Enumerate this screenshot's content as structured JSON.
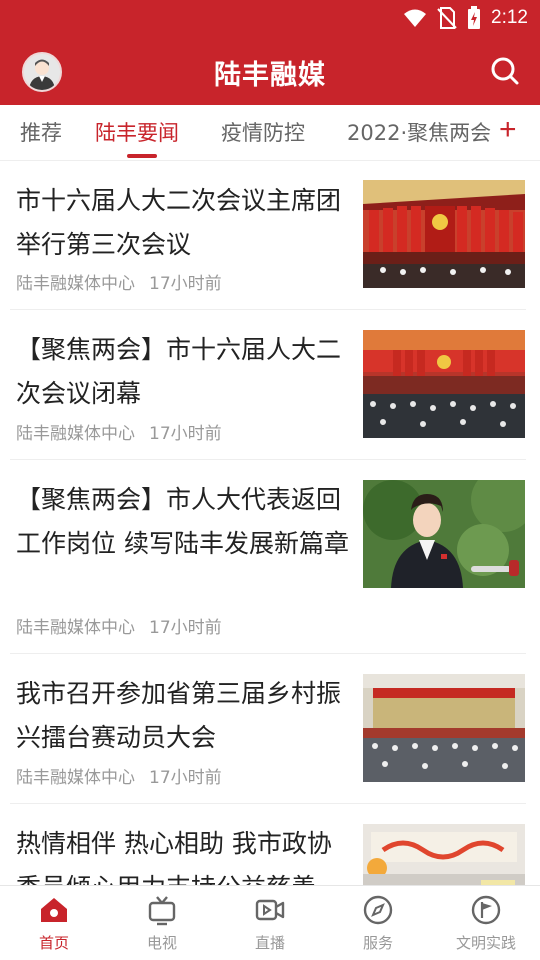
{
  "status_bar": {
    "time": "2:12"
  },
  "header": {
    "title": "陆丰融媒",
    "avatar_icon": "user-avatar",
    "search_icon": "search-icon"
  },
  "tabs": [
    {
      "label": "推荐",
      "active": false
    },
    {
      "label": "陆丰要闻",
      "active": true
    },
    {
      "label": "疫情防控",
      "active": false
    },
    {
      "label": "2022·聚焦两会",
      "active": false
    }
  ],
  "tab_add": "+",
  "news": [
    {
      "title": "市十六届人大二次会议主席团举行第三次会议",
      "source": "陆丰融媒体中心",
      "time": "17小时前",
      "thumb": "meeting-hall"
    },
    {
      "title": "【聚焦两会】市十六届人大二次会议闭幕",
      "source": "陆丰融媒体中心",
      "time": "17小时前",
      "thumb": "meeting-hall-wide"
    },
    {
      "title": "【聚焦两会】市人大代表返回工作岗位 续写陆丰发展新篇章",
      "source": "陆丰融媒体中心",
      "time": "17小时前",
      "thumb": "interview-portrait"
    },
    {
      "title": "我市召开参加省第三届乡村振兴擂台赛动员大会",
      "source": "陆丰融媒体中心",
      "time": "17小时前",
      "thumb": "conference-room"
    },
    {
      "title": "热情相伴 热心相助 我市政协委员倾心用力支持公益慈善",
      "source": "",
      "time": "",
      "thumb": "charity-stage"
    }
  ],
  "bottom_nav": [
    {
      "label": "首页",
      "icon": "home-icon",
      "active": true
    },
    {
      "label": "电视",
      "icon": "tv-icon",
      "active": false
    },
    {
      "label": "直播",
      "icon": "live-video-icon",
      "active": false
    },
    {
      "label": "服务",
      "icon": "compass-icon",
      "active": false
    },
    {
      "label": "文明实践",
      "icon": "flag-icon",
      "active": false
    }
  ],
  "colors": {
    "brand_red": "#c8242b",
    "text_dark": "#222222",
    "text_meta": "#999999"
  }
}
